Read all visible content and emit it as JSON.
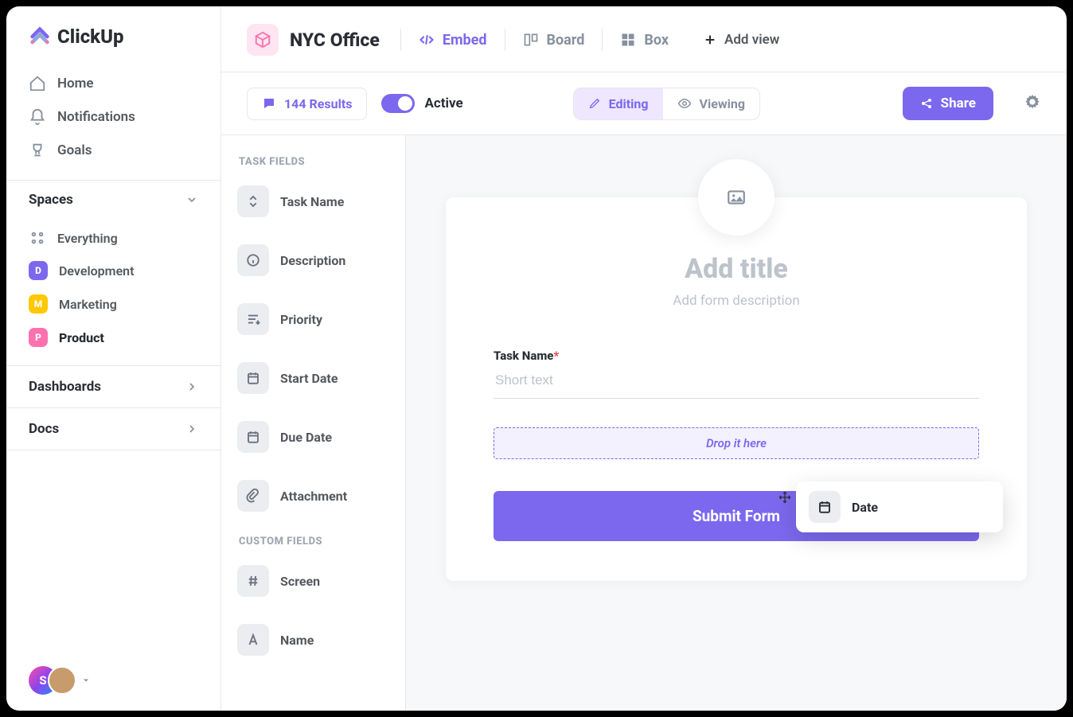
{
  "brand": "ClickUp",
  "nav": {
    "home": "Home",
    "notifications": "Notifications",
    "goals": "Goals"
  },
  "spaces": {
    "heading": "Spaces",
    "everything": "Everything",
    "items": [
      {
        "letter": "D",
        "label": "Development",
        "color": "#7b68ee"
      },
      {
        "letter": "M",
        "label": "Marketing",
        "color": "#ffc800"
      },
      {
        "letter": "P",
        "label": "Product",
        "color": "#fd71af"
      }
    ]
  },
  "sections": {
    "dashboards": "Dashboards",
    "docs": "Docs"
  },
  "avatar_initial": "S",
  "topbar": {
    "space_name": "NYC Office",
    "views": {
      "embed": "Embed",
      "board": "Board",
      "box": "Box"
    },
    "add_view": "Add view"
  },
  "toolbar": {
    "results_count": "144 Results",
    "active_label": "Active",
    "editing": "Editing",
    "viewing": "Viewing",
    "share": "Share"
  },
  "fields_panel": {
    "task_fields_heading": "TASK FIELDS",
    "custom_fields_heading": "CUSTOM FIELDS",
    "task_fields": {
      "task_name": "Task Name",
      "description": "Description",
      "priority": "Priority",
      "start_date": "Start Date",
      "due_date": "Due Date",
      "attachment": "Attachment"
    },
    "custom_fields": {
      "screen": "Screen",
      "name": "Name"
    }
  },
  "drag_chip": {
    "label": "Date"
  },
  "form": {
    "title_placeholder": "Add title",
    "desc_placeholder": "Add form description",
    "task_name_label": "Task Name",
    "task_name_placeholder": "Short text",
    "drop_hint": "Drop it here",
    "submit": "Submit Form"
  }
}
